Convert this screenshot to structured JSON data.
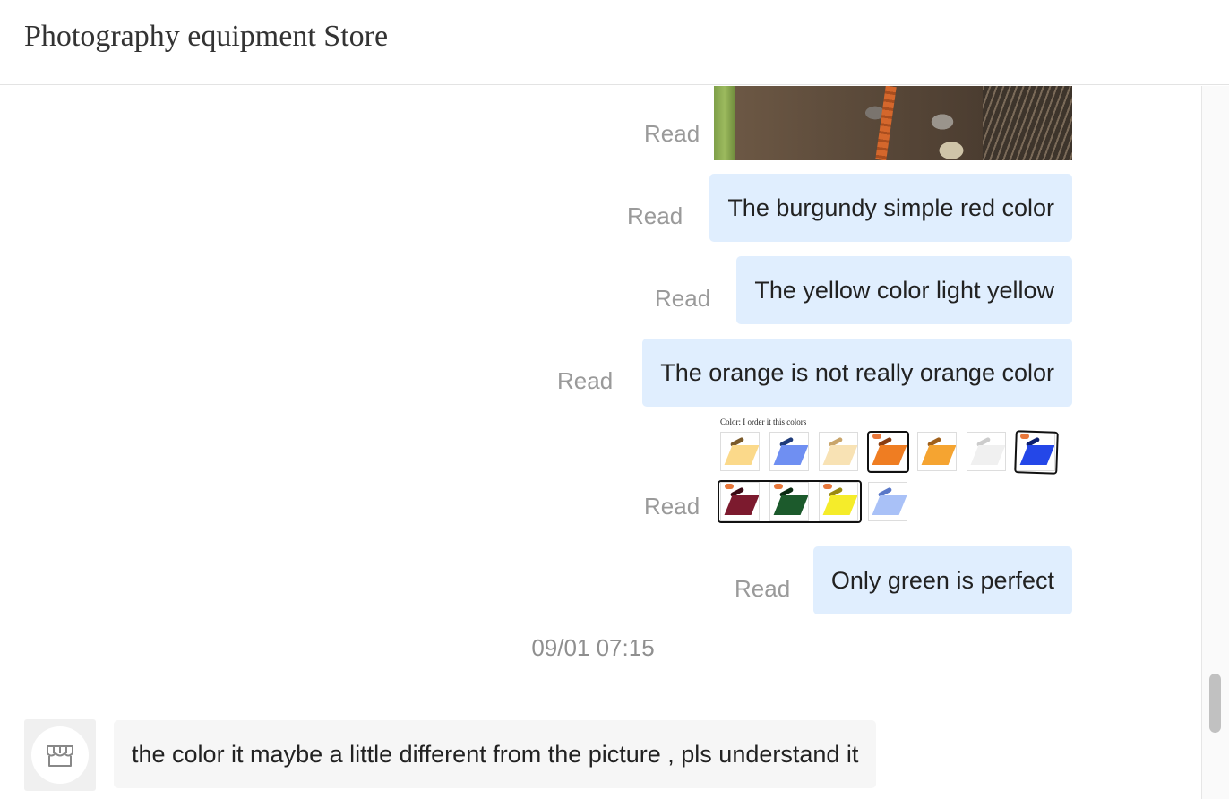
{
  "header": {
    "title": "Photography equipment Store"
  },
  "messages": [
    {
      "type": "image",
      "status": "Read"
    },
    {
      "type": "text",
      "status": "Read",
      "text": "The burgundy simple red color"
    },
    {
      "type": "text",
      "status": "Read",
      "text": "The yellow color light yellow"
    },
    {
      "type": "text",
      "status": "Read",
      "text": "The orange is not really orange color"
    },
    {
      "type": "image",
      "status": "Read",
      "caption": "Color:  I order it this colors",
      "swatches_row1": [
        "light-yellow",
        "blue",
        "pale-yellow",
        "orange",
        "amber",
        "clear",
        "deep-blue"
      ],
      "swatches_row2": [
        "burgundy",
        "green",
        "yellow",
        "light-blue"
      ]
    },
    {
      "type": "text",
      "status": "Read",
      "text": "Only green is perfect"
    }
  ],
  "timestamp": "09/01 07:15",
  "incoming": {
    "avatar_icon": "store-icon",
    "text": "the color it maybe a little different from the picture , pls understand it"
  },
  "colors": {
    "outgoing_bubble": "#e0eefe",
    "incoming_bubble": "#f6f6f6",
    "status_text": "#9a9a9a"
  }
}
